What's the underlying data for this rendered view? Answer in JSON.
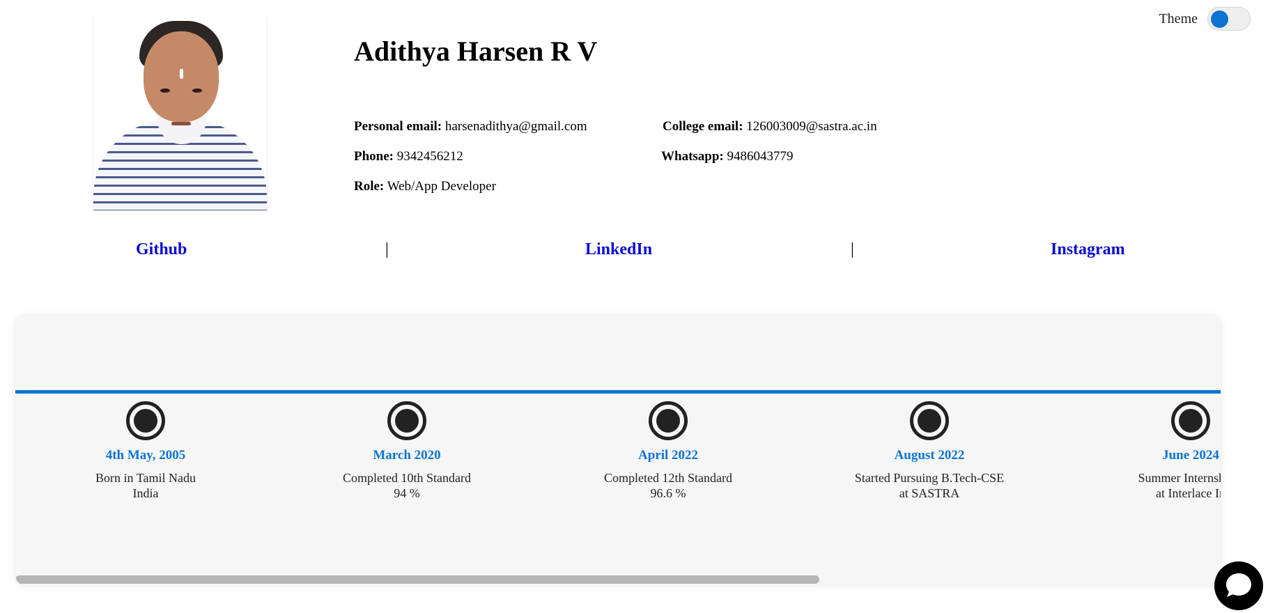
{
  "theme": {
    "label": "Theme",
    "accent": "#0b74d1"
  },
  "profile": {
    "name": "Adithya Harsen R V",
    "personal_email_label": "Personal email:",
    "personal_email": "harsenadithya@gmail.com",
    "college_email_label": "College email:",
    "college_email": "126003009@sastra.ac.in",
    "phone_label": "Phone:",
    "phone": "9342456212",
    "whatsapp_label": "Whatsapp:",
    "whatsapp": "9486043779",
    "role_label": "Role:",
    "role": "Web/App Developer"
  },
  "links": {
    "github": "Github",
    "separator": "|",
    "linkedin": "LinkedIn",
    "instagram": "Instagram",
    "color": "#0a0ad2"
  },
  "timeline": {
    "events": [
      {
        "date": "4th May, 2005",
        "line1": "Born in Tamil Nadu",
        "line2": "India"
      },
      {
        "date": "March 2020",
        "line1": "Completed 10th Standard",
        "line2": "94 %"
      },
      {
        "date": "April 2022",
        "line1": "Completed 12th Standard",
        "line2": "96.6 %"
      },
      {
        "date": "August 2022",
        "line1": "Started Pursuing B.Tech-CSE",
        "line2": "at SASTRA"
      },
      {
        "date": "June 2024",
        "line1": "Summer Internship a",
        "line2": "at Interlace In"
      }
    ]
  },
  "icons": {
    "chat": "chat-bubble-icon",
    "profile_photo": "profile-photo"
  }
}
